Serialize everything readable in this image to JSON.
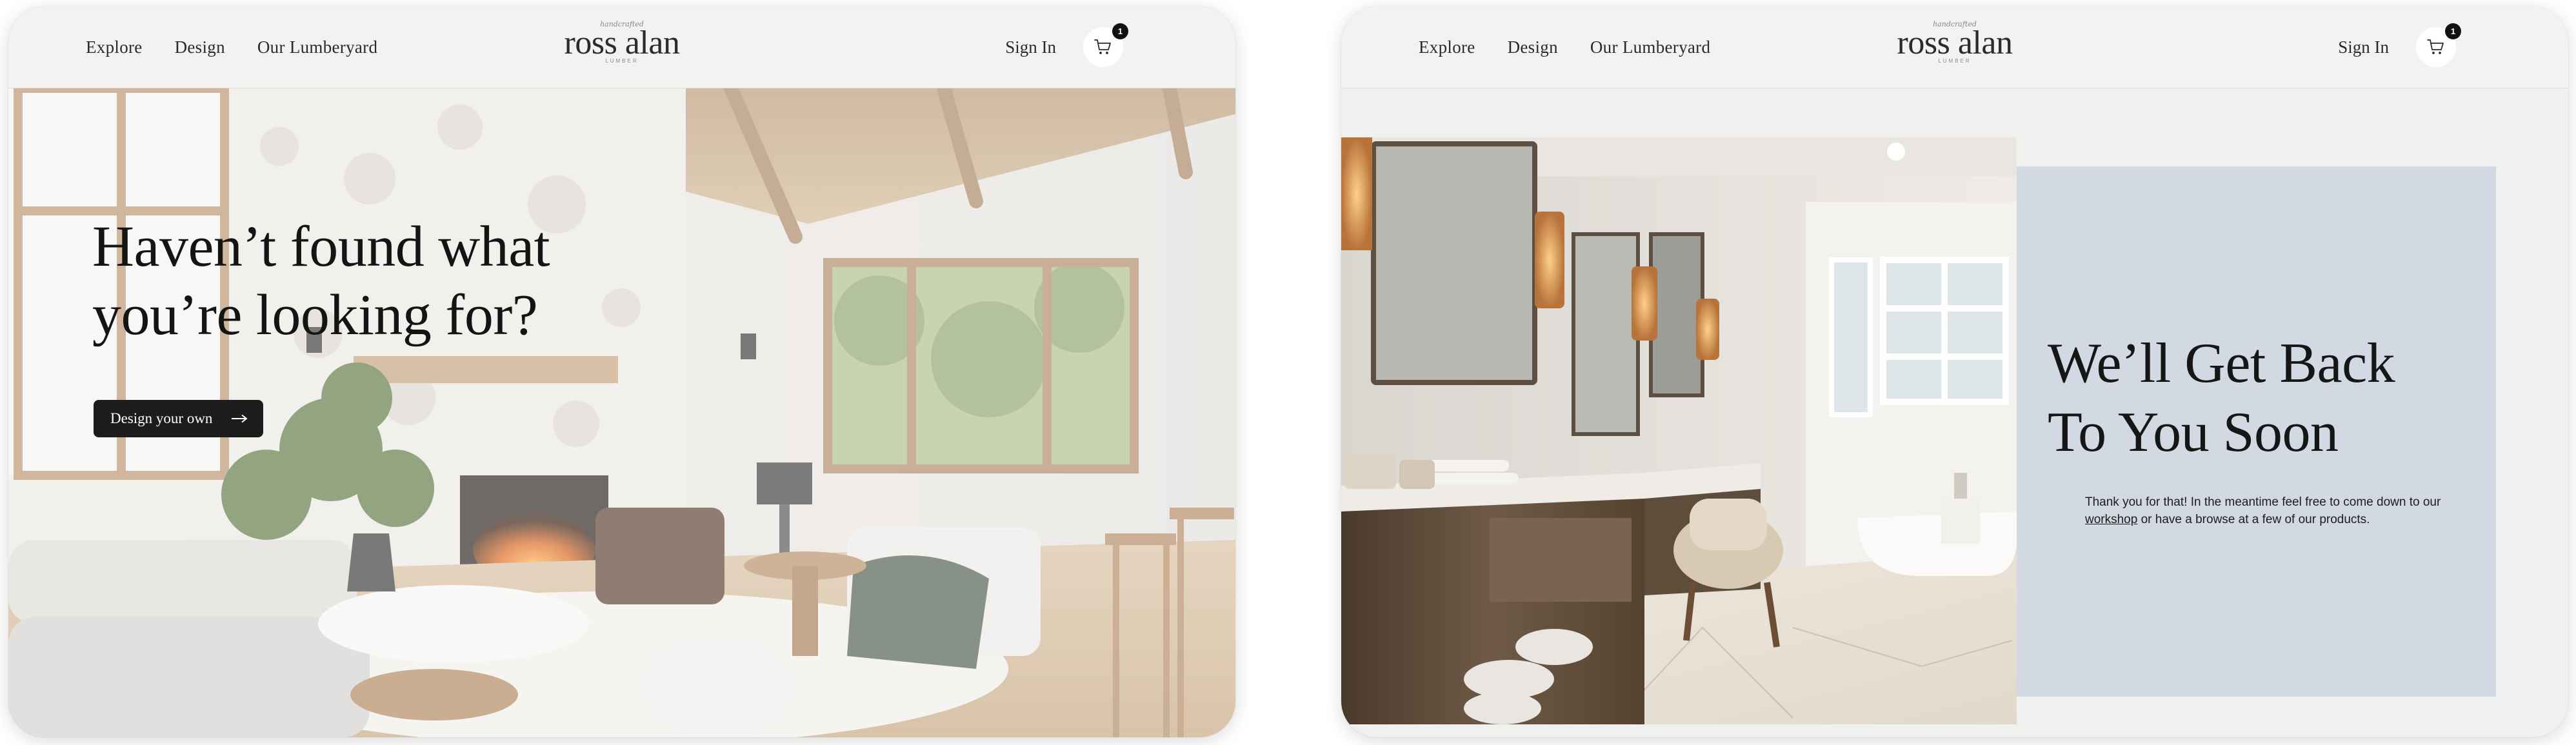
{
  "colors": {
    "nav_bg": "#f2f2f1",
    "button_bg": "#1b1c1b",
    "accent_panel": "#d3d9e2",
    "badge_bg": "#111111",
    "text_dark": "#141414"
  },
  "left_page": {
    "nav": {
      "links": [
        "Explore",
        "Design",
        "Our Lumberyard"
      ],
      "logo": {
        "script": "handcrafted",
        "name": "ross alan",
        "sub": "LUMBER"
      },
      "sign_in": "Sign In",
      "cart": {
        "icon": "cart-icon",
        "count": "1"
      }
    },
    "hero": {
      "title_line1": "Haven’t found what",
      "title_line2": "you’re looking for?",
      "button_label": "Design your own",
      "button_icon": "arrow-right-icon"
    }
  },
  "right_page": {
    "nav": {
      "links": [
        "Explore",
        "Design",
        "Our Lumberyard"
      ],
      "logo": {
        "script": "handcrafted",
        "name": "ross alan",
        "sub": "LUMBER"
      },
      "sign_in": "Sign In",
      "cart": {
        "icon": "cart-icon",
        "count": "1"
      }
    },
    "message": {
      "title_line1": "We’ll Get Back",
      "title_line2": "To You Soon",
      "body_part1": "Thank you for that! In the meantime feel free to come down to our ",
      "body_link": "workshop",
      "body_part2": " or have a browse at a few of our products."
    }
  }
}
